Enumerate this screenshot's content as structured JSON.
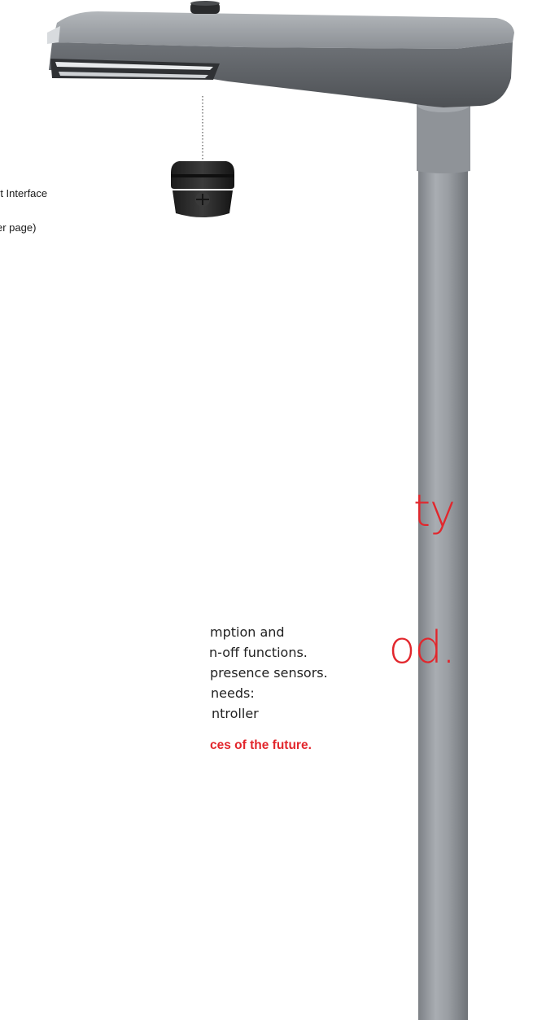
{
  "callout": {
    "line1": "rt Interface",
    "line2": "er page)"
  },
  "headline": {
    "line1": "ty",
    "line2": "od."
  },
  "body": {
    "lines": [
      "mption and",
      "n-off functions.",
      "presence sensors.",
      "needs:",
      "ntroller"
    ]
  },
  "tagline": "ces of the future.",
  "colors": {
    "accent_red": "#e2262c",
    "pole_grey": "#9a9ea3",
    "head_grey": "#8a8e93",
    "text": "#1a1a1a"
  },
  "illustration": {
    "luminaire_icon": "street-light-luminaire",
    "sensor_icon": "smart-interface-node"
  }
}
